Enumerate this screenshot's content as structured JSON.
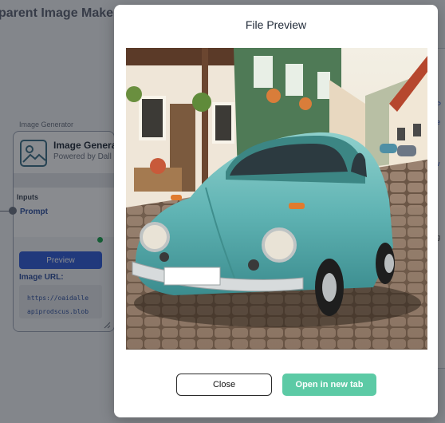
{
  "app": {
    "title": "parent Image Maker"
  },
  "node": {
    "caption": "Image Generator",
    "title": "Image Genera",
    "subtitle": "Powered by Dall",
    "inputs_label": "Inputs",
    "prompt_label": "Prompt",
    "preview_label": "Preview",
    "url_label": "Image URL:",
    "url_lines": [
      "https://oaidalle",
      "apiprodscus.blob"
    ]
  },
  "right_panel": {
    "fragments": [
      "P",
      "e",
      "v",
      "g"
    ]
  },
  "modal": {
    "title": "File Preview",
    "image_alt": "Turquoise vintage Volkswagen Beetle parked on a cobblestone street in a German village",
    "close_label": "Close",
    "open_label": "Open in new tab"
  },
  "colors": {
    "accent_blue": "#2f5bd8",
    "open_button": "#5ccaa5",
    "car": "#5fb3b3"
  },
  "icons": {
    "node_icon": "image-icon"
  }
}
